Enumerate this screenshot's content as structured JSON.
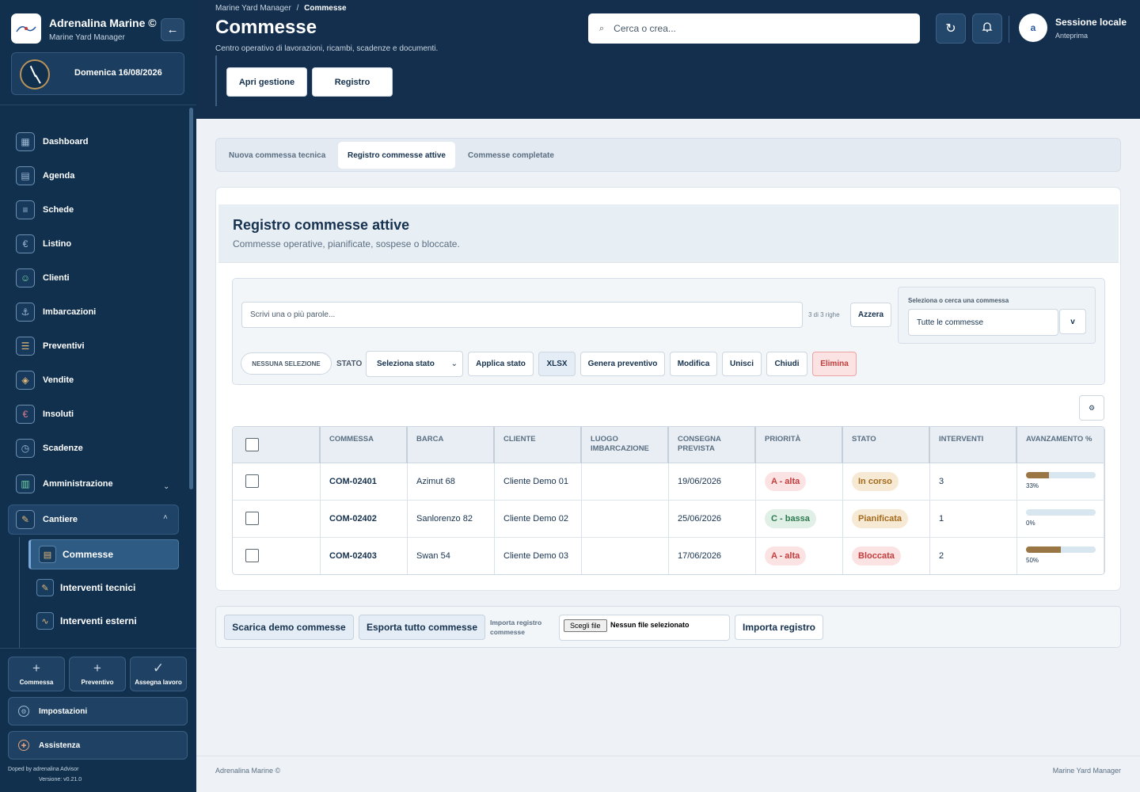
{
  "brand": {
    "name": "Adrenalina Marine ©",
    "subtitle": "Marine Yard Manager"
  },
  "date": "Domenica 16/08/2026",
  "nav": {
    "items": [
      {
        "label": "Dashboard",
        "icon": "grid-icon"
      },
      {
        "label": "Agenda",
        "icon": "calendar-icon"
      },
      {
        "label": "Schede",
        "icon": "document-icon"
      },
      {
        "label": "Listino",
        "icon": "euro-icon"
      },
      {
        "label": "Clienti",
        "icon": "user-icon"
      },
      {
        "label": "Imbarcazioni",
        "icon": "anchor-icon"
      },
      {
        "label": "Preventivi",
        "icon": "list-icon"
      },
      {
        "label": "Vendite",
        "icon": "tag-icon"
      },
      {
        "label": "Insoluti",
        "icon": "euro-icon"
      },
      {
        "label": "Scadenze",
        "icon": "clock-icon"
      },
      {
        "label": "Amministrazione",
        "icon": "building-icon"
      },
      {
        "label": "Cantiere",
        "icon": "wrench-icon"
      }
    ],
    "sub_items": [
      {
        "label": "Commesse"
      },
      {
        "label": "Interventi tecnici"
      },
      {
        "label": "Interventi esterni"
      }
    ]
  },
  "quick_actions": [
    "Commessa",
    "Preventivo",
    "Assegna lavoro"
  ],
  "settings_label": "Impostazioni",
  "help_label": "Assistenza",
  "sidebar_footer": {
    "credit": "Doped by adrenalina Advisor",
    "version": "Versione: v0.21.0"
  },
  "header": {
    "breadcrumb_root": "Marine Yard Manager",
    "breadcrumb_sep": "/",
    "breadcrumb_current": "Commesse",
    "title": "Commesse",
    "subtitle": "Centro operativo di lavorazioni, ricambi, scadenze e documenti.",
    "open_label": "Apri gestione",
    "registry_label": "Registro",
    "search_placeholder": "Cerca o crea...",
    "session_name": "Sessione locale",
    "session_sub": "Anteprima",
    "avatar_letter": "a"
  },
  "tabs": [
    "Nuova commessa tecnica",
    "Registro commesse attive",
    "Commesse completate"
  ],
  "card": {
    "title": "Registro commesse attive",
    "subtitle": "Commesse operative, pianificate, sospese o bloccate."
  },
  "filters": {
    "search_placeholder": "Scrivi una o più parole...",
    "row_count": "3 di 3 righe",
    "reset_label": "Azzera",
    "select_label": "Seleziona o cerca una commessa",
    "select_value": "Tutte le commesse",
    "select_arrow": "v",
    "no_selection": "NESSUNA SELEZIONE",
    "stato_label": "STATO",
    "stato_value": "Seleziona stato",
    "actions": {
      "apply": "Applica stato",
      "xlsx": "XLSX",
      "quote": "Genera preventivo",
      "edit": "Modifica",
      "merge": "Unisci",
      "close": "Chiudi",
      "delete": "Elimina"
    }
  },
  "table": {
    "columns": [
      "COMMESSA",
      "BARCA",
      "CLIENTE",
      "LUOGO IMBARCAZIONE",
      "CONSEGNA PREVISTA",
      "PRIORITÀ",
      "STATO",
      "INTERVENTI",
      "AVANZAMENTO %"
    ],
    "rows": [
      {
        "code": "COM-02401",
        "boat": "Azimut 68",
        "client": "Cliente Demo 01",
        "place": "",
        "delivery": "19/06/2026",
        "priority": "A - alta",
        "priority_level": "high",
        "status": "In corso",
        "status_kind": "progress",
        "interventions": "3",
        "progress": 33,
        "progress_label": "33%"
      },
      {
        "code": "COM-02402",
        "boat": "Sanlorenzo 82",
        "client": "Cliente Demo 02",
        "place": "",
        "delivery": "25/06/2026",
        "priority": "C - bassa",
        "priority_level": "low",
        "status": "Pianificata",
        "status_kind": "planned",
        "interventions": "1",
        "progress": 0,
        "progress_label": "0%"
      },
      {
        "code": "COM-02403",
        "boat": "Swan 54",
        "client": "Cliente Demo 03",
        "place": "",
        "delivery": "17/06/2026",
        "priority": "A - alta",
        "priority_level": "high",
        "status": "Bloccata",
        "status_kind": "blocked",
        "interventions": "2",
        "progress": 50,
        "progress_label": "50%"
      }
    ]
  },
  "bottom": {
    "demo_label": "Scarica demo commesse",
    "export_label": "Esporta tutto commesse",
    "import_label": "Importa registro commesse",
    "file_button": "Scegli file",
    "file_none": "Nessun file selezionato",
    "import_btn": "Importa registro"
  },
  "page_footer": {
    "left": "Adrenalina Marine ©",
    "right": "Marine Yard Manager"
  },
  "colors": {
    "sidebar": "#10304e",
    "topbar": "#132f4d",
    "high_bg": "#fbe3e3",
    "high_fg": "#c43c3c",
    "low_bg": "#e0f0e6",
    "low_fg": "#2e7a4f",
    "progress_bg": "#f7ead5",
    "progress_fg": "#a36a1c",
    "blocked_bg": "#fbe3e3",
    "blocked_fg": "#c43c3c",
    "bar": "#9b7645"
  }
}
